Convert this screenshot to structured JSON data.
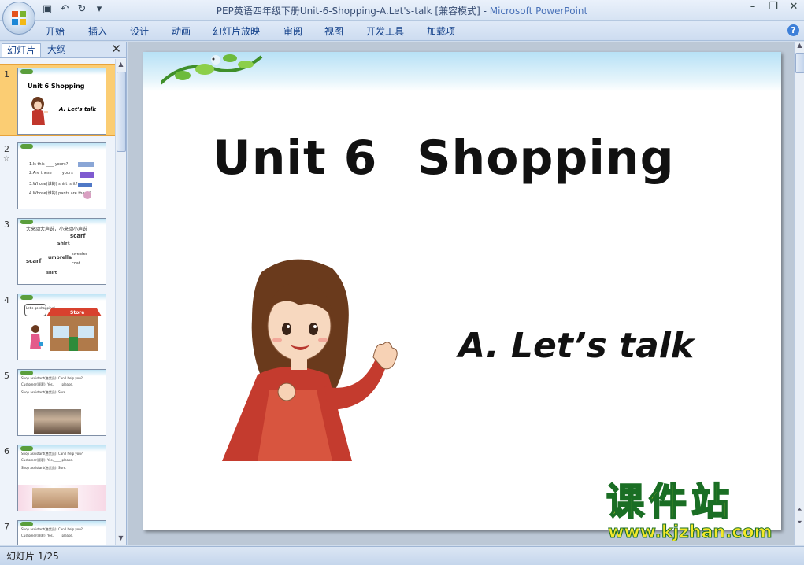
{
  "window": {
    "title_doc": "PEP英语四年级下册Unit-6-Shopping-A.Let's-talk [兼容模式] - ",
    "title_app": "Microsoft PowerPoint"
  },
  "ribbon_tabs": [
    "开始",
    "插入",
    "设计",
    "动画",
    "幻灯片放映",
    "审阅",
    "视图",
    "开发工具",
    "加载项"
  ],
  "panel": {
    "tab_slides": "幻灯片",
    "tab_outline": "大纲",
    "close_glyph": "✕"
  },
  "thumbnails": [
    {
      "num": "1",
      "title": "Unit 6  Shopping",
      "sub": "A. Let's talk"
    },
    {
      "num": "2",
      "lines": [
        "1.Is this ____ yours?",
        "2.Are these ____ yours ____",
        "3.Whose(谁的) shirt is it?",
        "4.Whose(谁的) pants are these?"
      ]
    },
    {
      "num": "3",
      "lines": [
        "大来动大声说，小来动小声说",
        "scarf",
        "shirt",
        "umbrella",
        "sweater",
        "coat"
      ]
    },
    {
      "num": "4",
      "lines": [
        "Let's go shopping!",
        "Store"
      ]
    },
    {
      "num": "5",
      "lines": [
        "Shop assistant(售货员): Can I help you?",
        "Customer(顾客): Yes, ____ please.",
        "Shop assistant(售货员): Sure."
      ]
    },
    {
      "num": "6",
      "lines": [
        "Shop assistant(售货员): Can I help you?",
        "Customer(顾客): Yes, ____ please.",
        "Shop assistant(售货员): Sure."
      ]
    },
    {
      "num": "7",
      "lines": [
        "Shop assistant(售货员): Can I help you?",
        "Customer(顾客): Yes, ____ please."
      ]
    }
  ],
  "slide": {
    "title_a": "Unit 6",
    "title_b": "Shopping",
    "subtitle": "A. Let’s talk"
  },
  "watermark": {
    "cn": "课件站",
    "url": "www.kjzhan.com"
  },
  "status": {
    "slide_counter": "幻灯片 1/25"
  }
}
